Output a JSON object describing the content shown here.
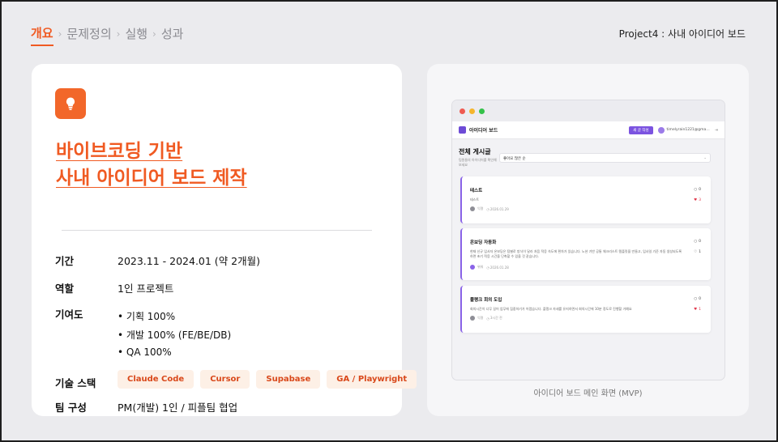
{
  "breadcrumb": [
    "개요",
    "문제정의",
    "실행",
    "성과"
  ],
  "project_label": "Project4 : 사내 아이디어 보드",
  "icon": "lightbulb-icon",
  "title_lines": [
    "바이브코딩 기반",
    "사내 아이디어 보드 제작"
  ],
  "info": {
    "period_label": "기간",
    "period_value": "2023.11 - 2024.01 (약 2개월)",
    "role_label": "역할",
    "role_value": "1인 프로젝트",
    "contrib_label": "기여도",
    "contrib_items": [
      "기획 100%",
      "개발 100% (FE/BE/DB)",
      "QA 100%"
    ],
    "tech_label": "기술 스택",
    "tech_tags": [
      "Claude Code",
      "Cursor",
      "Supabase",
      "GA / Playwright"
    ],
    "team_label": "팀 구성",
    "team_value": "PM(개발) 1인 / 피플팀 협업"
  },
  "mockup": {
    "brand": "아이디어 보드",
    "new_button": "새 글 작성",
    "user": "timelyrain1221@gma…",
    "heading": "전체 게시글",
    "sub": "팀원들의 아이디어를 확인해보세요",
    "sort": "좋아요 많은 순",
    "posts": [
      {
        "title": "테스트",
        "text": "테스트",
        "author": "익명",
        "date": "2026.01.29",
        "comments": "0",
        "likes": "3"
      },
      {
        "title": "온보딩 자동화",
        "text": "현재 신규 입사자 온보딩은 팀별로 방식이 달라 처음 적응 속도에 편차가 있습니다. 노션 기반 공통 체크리스트 템플릿을 만들고, 입사일 기준 자동 생성되도록 하면 초기 적응 시간을 단축할 수 있을 것 같습니다.",
        "author": "위워",
        "date": "2026.01.28",
        "comments": "0",
        "likes": "1"
      },
      {
        "title": "플랭크 회의 도입",
        "text": "회의시간이 너무 길어 업무에 집중하기가 어렵습니다. 플랭크 자세를 유지하면서 회의시간에 10분 정도로 진행할 거예요",
        "author": "익명",
        "date": "3시간 전",
        "comments": "0",
        "likes": "1"
      }
    ],
    "caption": "아이디어 보드 메인 화면 (MVP)"
  },
  "colors": {
    "accent": "#f05a22",
    "purple": "#7b53e0"
  }
}
